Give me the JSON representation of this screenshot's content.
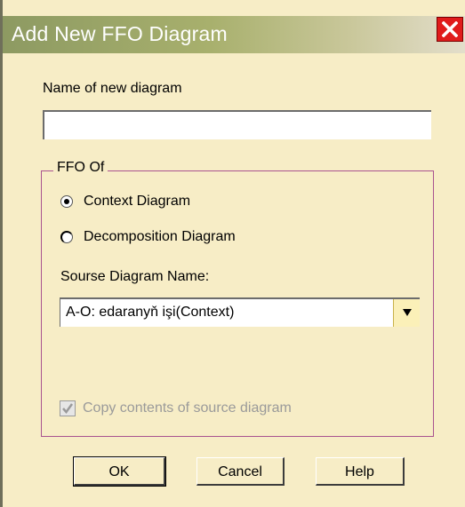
{
  "dialog": {
    "title": "Add New FFO Diagram",
    "name_label": "Name of new diagram",
    "name_value": "",
    "group_label": "FFO Of",
    "radio_context": "Context Diagram",
    "radio_decomposition": "Decomposition Diagram",
    "selected_radio": "Context Diagram",
    "source_label": "Sourse Diagram Name:",
    "source_value": "A-O: edaranyň işi(Context)",
    "copy_label": "Copy contents of source diagram",
    "copy_checked": true,
    "copy_enabled": false
  },
  "buttons": {
    "ok": "OK",
    "cancel": "Cancel",
    "help": "Help"
  },
  "colors": {
    "background": "#f7edc6",
    "title_gradient_start": "#8d9a62",
    "close_button": "#e01c1c",
    "group_border": "#a9538f"
  },
  "icons": {
    "close": "close-icon",
    "dropdown": "chevron-down-icon",
    "check": "check-icon"
  }
}
